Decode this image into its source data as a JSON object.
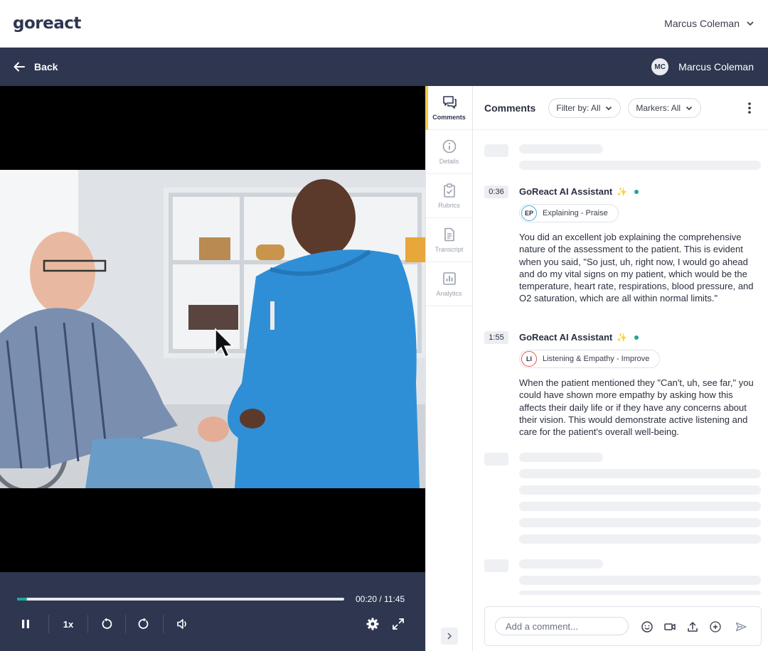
{
  "brand": {
    "logo_text": "goreact"
  },
  "header": {
    "user_name": "Marcus Coleman"
  },
  "navbar": {
    "back_label": "Back",
    "avatar_initials": "MC",
    "user_name": "Marcus Coleman"
  },
  "player": {
    "progress_fraction": 0.03,
    "current_time": "00:20",
    "total_time": "11:45",
    "time_display": "00:20 / 11:45",
    "speed_label": "1x",
    "icons": [
      "pause-icon",
      "rewind-icon",
      "forward-icon",
      "volume-icon",
      "settings-icon",
      "fullscreen-icon"
    ]
  },
  "side_tabs": [
    {
      "label": "Comments",
      "icon": "comments-icon",
      "active": true
    },
    {
      "label": "Details",
      "icon": "info-icon",
      "active": false
    },
    {
      "label": "Rubrics",
      "icon": "clipboard-check-icon",
      "active": false
    },
    {
      "label": "Transcript",
      "icon": "document-icon",
      "active": false
    },
    {
      "label": "Analytics",
      "icon": "bar-chart-icon",
      "active": false
    }
  ],
  "comments_panel": {
    "title": "Comments",
    "filter_label": "Filter by: All",
    "markers_label": "Markers: All",
    "comments": [
      {
        "timestamp": "0:36",
        "author": "GoReact AI Assistant",
        "tag_initials": "EP",
        "tag_label": "Explaining - Praise",
        "tag_color": "#4aa8d8",
        "text": "You did an excellent job explaining the comprehensive nature of the assessment to the patient. This is evident when you said, \"So just, uh, right now, I would go ahead and do my vital signs on my patient, which would be the temperature, heart rate, respirations, blood pressure, and O2 saturation, which are all within normal limits.\""
      },
      {
        "timestamp": "1:55",
        "author": "GoReact AI Assistant",
        "tag_initials": "LI",
        "tag_label": "Listening & Empathy - Improve",
        "tag_color": "#e05a4f",
        "text": "When the patient mentioned they \"Can't, uh, see far,\" you could have shown more empathy by asking how this affects their daily life or if they have any concerns about their vision. This would demonstrate active listening and care for the patient's overall well-being."
      }
    ],
    "composer_placeholder": "Add a comment..."
  },
  "colors": {
    "navy": "#2e3650",
    "teal": "#21a59a",
    "active_tab_accent": "#f2c94c"
  }
}
